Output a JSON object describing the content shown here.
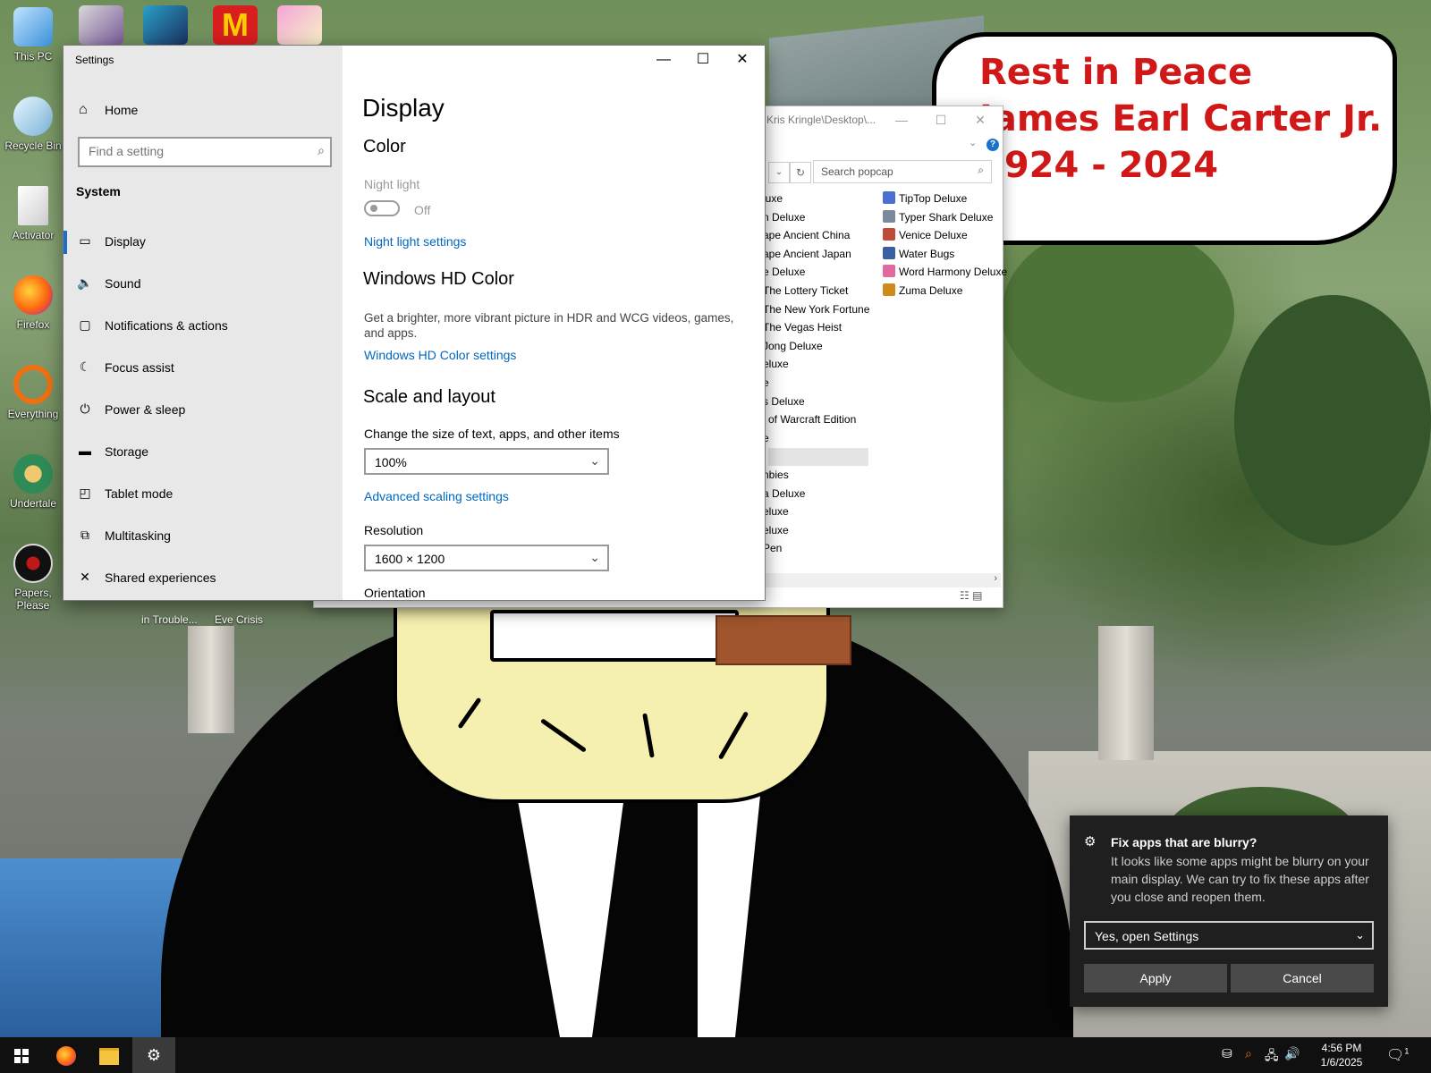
{
  "desktop": {
    "icons": [
      {
        "label": "This PC",
        "icon": "computer-icon",
        "color": "#3a8fd8"
      },
      {
        "label": "Recycle Bin",
        "icon": "recycle-bin-icon",
        "color": "#7ab4d8"
      },
      {
        "label": "Activator",
        "icon": "document-icon",
        "color": "#e6e6e6"
      },
      {
        "label": "Firefox",
        "icon": "firefox-icon",
        "color": "#ff6611"
      },
      {
        "label": "Everything",
        "icon": "magnifier-icon",
        "color": "#f07010"
      },
      {
        "label": "Undertale",
        "icon": "undertale-icon",
        "color": "#2e8b57"
      },
      {
        "label": "Papers, Please",
        "icon": "papers-please-icon",
        "color": "#111111"
      }
    ],
    "under_labels": [
      "in Trouble...",
      "Eve Crisis"
    ],
    "speech_bubble": [
      "Rest in Peace",
      "James Earl Carter Jr.",
      "1924 - 2024"
    ]
  },
  "explorer": {
    "title": "Kris Kringle\\Desktop\\...",
    "search_placeholder": "Search popcap",
    "left_column": [
      "luxe",
      "n Deluxe",
      "ape Ancient China",
      "ape Ancient Japan",
      "e Deluxe",
      "The Lottery Ticket",
      "The New York Fortune",
      "The Vegas Heist",
      "Jong Deluxe",
      "eluxe",
      "e",
      "s Deluxe",
      "l of Warcraft Edition",
      "e",
      "",
      "nbies",
      "a Deluxe",
      "eluxe",
      "eluxe",
      "Pen"
    ],
    "right_column": [
      {
        "label": "TipTop Deluxe",
        "color": "#4a6fd0"
      },
      {
        "label": "Typer Shark Deluxe",
        "color": "#7a8a9a"
      },
      {
        "label": "Venice Deluxe",
        "color": "#c04a3a"
      },
      {
        "label": "Water Bugs",
        "color": "#3a5fa0"
      },
      {
        "label": "Word Harmony Deluxe",
        "color": "#e06aa0"
      },
      {
        "label": "Zuma Deluxe",
        "color": "#d08a1a"
      }
    ]
  },
  "settings": {
    "window_title": "Settings",
    "home_label": "Home",
    "search_placeholder": "Find a setting",
    "system_heading": "System",
    "nav": [
      {
        "label": "Display",
        "icon": "monitor-icon",
        "glyph": "▭",
        "active": true
      },
      {
        "label": "Sound",
        "icon": "speaker-icon",
        "glyph": "🔈",
        "active": false
      },
      {
        "label": "Notifications & actions",
        "icon": "notification-icon",
        "glyph": "▢",
        "active": false
      },
      {
        "label": "Focus assist",
        "icon": "moon-icon",
        "glyph": "☾",
        "active": false
      },
      {
        "label": "Power & sleep",
        "icon": "power-icon",
        "glyph": "⏻",
        "active": false
      },
      {
        "label": "Storage",
        "icon": "storage-icon",
        "glyph": "▬",
        "active": false
      },
      {
        "label": "Tablet mode",
        "icon": "tablet-icon",
        "glyph": "◰",
        "active": false
      },
      {
        "label": "Multitasking",
        "icon": "multitasking-icon",
        "glyph": "⧉",
        "active": false
      },
      {
        "label": "Shared experiences",
        "icon": "shared-experiences-icon",
        "glyph": "✕",
        "active": false
      }
    ],
    "page_title": "Display",
    "color_heading": "Color",
    "night_light_label": "Night light",
    "night_light_state": "Off",
    "night_light_settings_link": "Night light settings",
    "hdr_heading": "Windows HD Color",
    "hdr_desc": "Get a brighter, more vibrant picture in HDR and WCG videos, games, and apps.",
    "hdr_link": "Windows HD Color settings",
    "scale_heading": "Scale and layout",
    "scale_label": "Change the size of text, apps, and other items",
    "scale_value": "100%",
    "advanced_scaling_link": "Advanced scaling settings",
    "resolution_label": "Resolution",
    "resolution_value": "1600 × 1200",
    "orientation_label": "Orientation"
  },
  "toast": {
    "title": "Fix apps that are blurry?",
    "body": "It looks like some apps might be blurry on your main display. We can try to fix these apps after you close and reopen them.",
    "select_value": "Yes, open Settings",
    "apply_label": "Apply",
    "cancel_label": "Cancel"
  },
  "taskbar": {
    "time": "4:56 PM",
    "date": "1/6/2025",
    "notification_count": "1"
  },
  "colors": {
    "accent": "#0067c0",
    "sidebar_bg": "#e8e8e8",
    "toast_bg": "#1f1f1f",
    "bubble_text": "#d01818"
  }
}
